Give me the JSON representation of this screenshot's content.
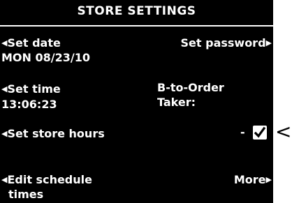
{
  "screen": {
    "title": "STORE SETTINGS",
    "left_menu": {
      "set_date_label": "Set date",
      "date_value": "MON 08/23/10",
      "set_time_label": "Set time",
      "time_value": "13:06:23",
      "store_hours_label": "Set store hours",
      "edit_schedule_line1": "Edit schedule",
      "edit_schedule_line2": "times"
    },
    "right_menu": {
      "set_password_label": "Set password",
      "b_to_order_line1": "B-to-Order",
      "b_to_order_line2": "Taker:",
      "checkbox_prefix": "-",
      "checkbox_checked": true,
      "more_label": "More"
    },
    "arrow_left_icon": "triangle-left-icon",
    "arrow_right_icon": "triangle-right-icon",
    "checkmark_icon": "checkmark-icon",
    "callout_pointer": "<",
    "colors": {
      "screen_bg": "#000000",
      "text": "#ffffff",
      "page_bg": "#ffffff"
    }
  }
}
